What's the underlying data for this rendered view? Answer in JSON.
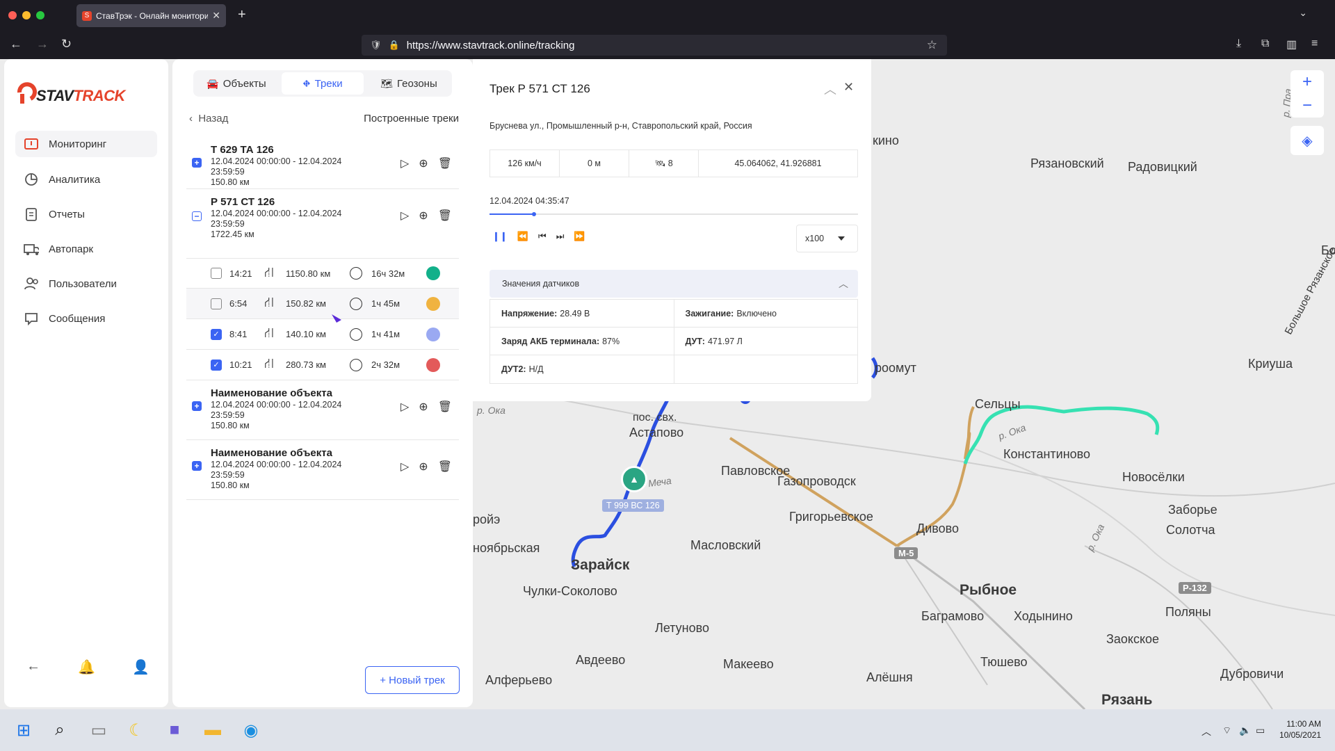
{
  "browser": {
    "tab_title": "СтавТрэк - Онлайн мониторинг",
    "url": "https://www.stavtrack.online/tracking"
  },
  "sidebar": {
    "logo_text": "STAVTRACK",
    "items": [
      {
        "label": "Мониторинг",
        "icon": "map-icon"
      },
      {
        "label": "Аналитика",
        "icon": "pie-chart-icon"
      },
      {
        "label": "Отчеты",
        "icon": "clipboard-icon"
      },
      {
        "label": "Автопарк",
        "icon": "truck-icon"
      },
      {
        "label": "Пользователи",
        "icon": "users-icon"
      },
      {
        "label": "Сообщения",
        "icon": "message-icon"
      }
    ]
  },
  "panel": {
    "tabs": [
      {
        "label": "Объекты",
        "icon": "car-icon"
      },
      {
        "label": "Треки",
        "icon": "route-icon"
      },
      {
        "label": "Геозоны",
        "icon": "map-fold-icon"
      }
    ],
    "back_label": "Назад",
    "section_title": "Построенные треки",
    "tracks": [
      {
        "name": "Т 629 ТА 126",
        "dates": "12.04.2024 00:00:00 - 12.04.2024 23:59:59",
        "distance": "150.80 км",
        "expanded": false
      },
      {
        "name": "Р 571 СТ 126",
        "dates": "12.04.2024 00:00:00 - 12.04.2024 23:59:59",
        "distance": "1722.45 км",
        "expanded": true
      },
      {
        "name": "Наименование объекта",
        "dates": "12.04.2024 00:00:00 - 12.04.2024 23:59:59",
        "distance": "150.80 км",
        "expanded": false
      },
      {
        "name": "Наименование объекта",
        "dates": "12.04.2024 00:00:00 - 12.04.2024 23:59:59",
        "distance": "150.80 км",
        "expanded": false
      }
    ],
    "segments": [
      {
        "time": "14:21",
        "distance": "1150.80 км",
        "duration": "16ч 32м",
        "color": "#12b08a",
        "checked": false
      },
      {
        "time": "6:54",
        "distance": "150.82 км",
        "duration": "1ч 45м",
        "color": "#f0b340",
        "checked": false
      },
      {
        "time": "8:41",
        "distance": "140.10 км",
        "duration": "1ч 41м",
        "color": "#9aa9f2",
        "checked": true
      },
      {
        "time": "10:21",
        "distance": "280.73 км",
        "duration": "2ч 32м",
        "color": "#e35a5a",
        "checked": true
      }
    ],
    "new_track_label": "+ Новый трек"
  },
  "detail": {
    "title": "Трек Р 571 СТ 126",
    "address": "Бруснева ул., Промышленный р-н, Ставропольский край, Россия",
    "speed": "126 км/ч",
    "altitude": "0 м",
    "satellites": "8",
    "coords": "45.064062, 41.926881",
    "timestamp": "12.04.2024 04:35:47",
    "progress": 0.12,
    "playback_speed": "x100",
    "sensors_title": "Значения датчиков",
    "sensors": [
      [
        {
          "k": "Напряжение:",
          "v": "28.49 В"
        },
        {
          "k": "Зажигание:",
          "v": "Включено"
        }
      ],
      [
        {
          "k": "Заряд АКБ терминала:",
          "v": "87%"
        },
        {
          "k": "ДУТ:",
          "v": "471.97 Л"
        }
      ],
      [
        {
          "k": "ДУТ2:",
          "v": "Н/Д"
        },
        {
          "k": "",
          "v": ""
        }
      ]
    ]
  },
  "map": {
    "vehicle_plate": "Т 999 ВС 126",
    "labels": [
      "Рязановский",
      "Радовицкий",
      "Криуша",
      "Сельцы",
      "Константиново",
      "Новосёлки",
      "Заборье",
      "Солотча",
      "Павловское",
      "Газопроводск",
      "Григорьевское",
      "Дивово",
      "Масловский",
      "Рыбное",
      "Баграмово",
      "Ходынино",
      "Поляны",
      "Заокское",
      "Тюшево",
      "Алёшня",
      "Дубровичи",
      "Рязань",
      "Зарайск",
      "Чулки-Соколово",
      "Летуново",
      "Авдеево",
      "Макеево",
      "Алферьево",
      "пос. свх.",
      "Астапово",
      "ройэ",
      "ноябрьская",
      "кино",
      "роомут",
      "Большое Рязанское",
      "Бо"
    ],
    "rivers": [
      "р. Ока",
      "Меча",
      "р. Ока",
      "р. Ока",
      "р. Пра"
    ],
    "road_signs": [
      "М-5",
      "Р-132"
    ]
  },
  "taskbar": {
    "time": "11:00 AM",
    "date": "10/05/2021"
  }
}
